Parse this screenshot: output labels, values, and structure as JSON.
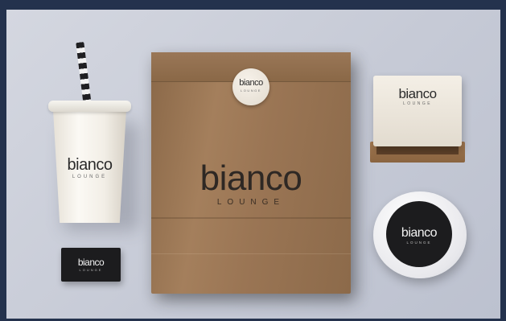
{
  "brand": {
    "name": "bianco",
    "subname": "LOUNGE",
    "text_dark": "#2b2b2b",
    "text_light": "#f2f2f2",
    "kraft": "#a47f5c",
    "background": "#c9cdd8",
    "frame": "#24324d"
  },
  "items": {
    "cup": {
      "icon": "paper-cup-with-straw",
      "name": "bianco",
      "sub": "LOUNGE"
    },
    "business_card": {
      "icon": "business-card",
      "name": "bianco",
      "sub": "LOUNGE"
    },
    "paper_bag": {
      "icon": "kraft-paper-bag",
      "name": "bianco",
      "sub": "LOUNGE",
      "sticker_name": "bianco",
      "sticker_sub": "LOUNGE"
    },
    "burger_box": {
      "icon": "burger-box",
      "name": "bianco",
      "sub": "LOUNGE"
    },
    "wrapped_burger": {
      "icon": "wrapped-burger",
      "name": "bianco",
      "sub": "LOUNGE"
    }
  }
}
